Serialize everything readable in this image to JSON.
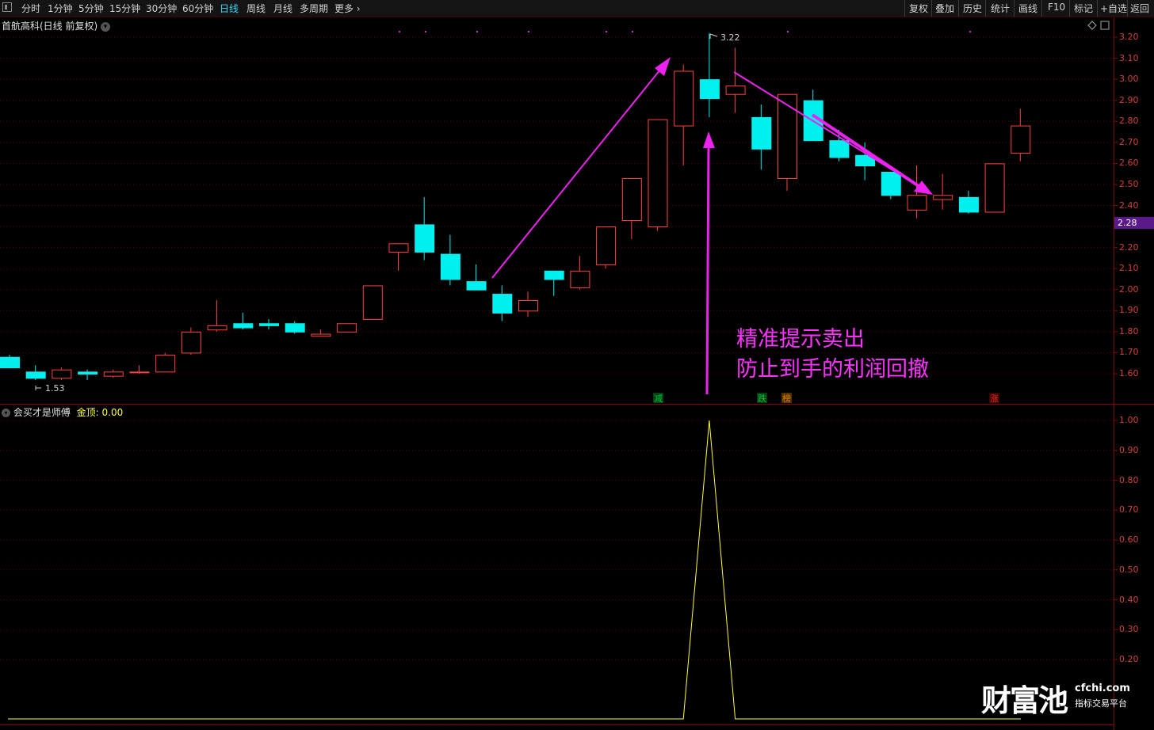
{
  "toolbar": {
    "left_items": [
      "分时",
      "1分钟",
      "5分钟",
      "15分钟",
      "30分钟",
      "60分钟",
      "日线",
      "周线",
      "月线",
      "多周期",
      "更多"
    ],
    "active_item": "日线",
    "right_items": [
      "复权",
      "叠加",
      "历史",
      "统计",
      "画线",
      "F10",
      "标记",
      "+自选",
      "返回"
    ]
  },
  "stock": {
    "title": "首航高科(日线 前复权)",
    "current_price": "2.28",
    "high_label": "3.22",
    "low_label": "1.53"
  },
  "price_axis": {
    "labels": [
      "3.20",
      "3.10",
      "3.00",
      "2.90",
      "2.80",
      "2.70",
      "2.60",
      "2.50",
      "2.40",
      "2.30",
      "2.20",
      "2.10",
      "2.00",
      "1.90",
      "1.80",
      "1.70",
      "1.60"
    ]
  },
  "indicator": {
    "name": "会买才是师傅",
    "series_label": "金顶:",
    "series_value": "0.00",
    "axis_labels": [
      "1.00",
      "0.90",
      "0.80",
      "0.70",
      "0.60",
      "0.50",
      "0.40",
      "0.30",
      "0.20"
    ]
  },
  "signals": [
    {
      "text": "减",
      "color": "#00c040"
    },
    {
      "text": "跌",
      "color": "#00c040"
    },
    {
      "text": "榜",
      "color": "#e08000"
    },
    {
      "text": "涨",
      "color": "#e03030"
    }
  ],
  "annotation": {
    "line1": "精准提示卖出",
    "line2": "防止到手的利润回撤"
  },
  "watermark": {
    "brand": "财富池",
    "site": "cfchi.com",
    "tagline": "指标交易平台"
  },
  "colors": {
    "up": "#ff4040",
    "down": "#00f0f0",
    "arrow": "#ee22ee",
    "indicator_line": "#ffff30",
    "grid": "#5a0000"
  },
  "chart_data": {
    "type": "candlestick",
    "candles": [
      {
        "o": 1.68,
        "h": 1.69,
        "l": 1.63,
        "c": 1.63
      },
      {
        "o": 1.61,
        "h": 1.64,
        "l": 1.57,
        "c": 1.58
      },
      {
        "o": 1.58,
        "h": 1.63,
        "l": 1.57,
        "c": 1.62
      },
      {
        "o": 1.61,
        "h": 1.62,
        "l": 1.57,
        "c": 1.6
      },
      {
        "o": 1.59,
        "h": 1.62,
        "l": 1.58,
        "c": 1.61
      },
      {
        "o": 1.61,
        "h": 1.64,
        "l": 1.6,
        "c": 1.61
      },
      {
        "o": 1.61,
        "h": 1.7,
        "l": 1.61,
        "c": 1.69
      },
      {
        "o": 1.7,
        "h": 1.82,
        "l": 1.69,
        "c": 1.8
      },
      {
        "o": 1.81,
        "h": 1.95,
        "l": 1.8,
        "c": 1.83
      },
      {
        "o": 1.84,
        "h": 1.89,
        "l": 1.81,
        "c": 1.82
      },
      {
        "o": 1.84,
        "h": 1.86,
        "l": 1.81,
        "c": 1.83
      },
      {
        "o": 1.84,
        "h": 1.85,
        "l": 1.79,
        "c": 1.8
      },
      {
        "o": 1.78,
        "h": 1.81,
        "l": 1.78,
        "c": 1.79
      },
      {
        "o": 1.8,
        "h": 1.84,
        "l": 1.8,
        "c": 1.84
      },
      {
        "o": 1.86,
        "h": 2.02,
        "l": 1.86,
        "c": 2.02
      },
      {
        "o": 2.18,
        "h": 2.22,
        "l": 2.09,
        "c": 2.22
      },
      {
        "o": 2.31,
        "h": 2.44,
        "l": 2.14,
        "c": 2.18
      },
      {
        "o": 2.17,
        "h": 2.26,
        "l": 2.02,
        "c": 2.05
      },
      {
        "o": 2.04,
        "h": 2.12,
        "l": 2.0,
        "c": 2.0
      },
      {
        "o": 1.98,
        "h": 2.02,
        "l": 1.85,
        "c": 1.89
      },
      {
        "o": 1.9,
        "h": 1.99,
        "l": 1.87,
        "c": 1.95
      },
      {
        "o": 2.09,
        "h": 2.09,
        "l": 1.97,
        "c": 2.05
      },
      {
        "o": 2.01,
        "h": 2.16,
        "l": 2.0,
        "c": 2.09
      },
      {
        "o": 2.12,
        "h": 2.3,
        "l": 2.1,
        "c": 2.3
      },
      {
        "o": 2.33,
        "h": 2.53,
        "l": 2.24,
        "c": 2.53
      },
      {
        "o": 2.3,
        "h": 2.81,
        "l": 2.28,
        "c": 2.81
      },
      {
        "o": 2.78,
        "h": 3.07,
        "l": 2.59,
        "c": 3.04
      },
      {
        "o": 3.0,
        "h": 3.22,
        "l": 2.82,
        "c": 2.91
      },
      {
        "o": 2.93,
        "h": 3.15,
        "l": 2.84,
        "c": 2.97
      },
      {
        "o": 2.82,
        "h": 2.88,
        "l": 2.57,
        "c": 2.67
      },
      {
        "o": 2.53,
        "h": 2.93,
        "l": 2.47,
        "c": 2.93
      },
      {
        "o": 2.9,
        "h": 2.95,
        "l": 2.71,
        "c": 2.71
      },
      {
        "o": 2.71,
        "h": 2.76,
        "l": 2.61,
        "c": 2.63
      },
      {
        "o": 2.64,
        "h": 2.7,
        "l": 2.52,
        "c": 2.59
      },
      {
        "o": 2.56,
        "h": 2.56,
        "l": 2.43,
        "c": 2.45
      },
      {
        "o": 2.38,
        "h": 2.59,
        "l": 2.34,
        "c": 2.45
      },
      {
        "o": 2.43,
        "h": 2.55,
        "l": 2.38,
        "c": 2.45
      },
      {
        "o": 2.44,
        "h": 2.47,
        "l": 2.36,
        "c": 2.37
      },
      {
        "o": 2.37,
        "h": 2.6,
        "l": 2.37,
        "c": 2.6
      },
      {
        "o": 2.65,
        "h": 2.86,
        "l": 2.61,
        "c": 2.78
      }
    ],
    "indicator_values": [
      0,
      0,
      0,
      0,
      0,
      0,
      0,
      0,
      0,
      0,
      0,
      0,
      0,
      0,
      0,
      0,
      0,
      0,
      0,
      0,
      0,
      0,
      0,
      0,
      0,
      0,
      0,
      1,
      0,
      0,
      0,
      0,
      0,
      0,
      0,
      0,
      0,
      0,
      0,
      0
    ],
    "ylim_price": [
      1.5,
      3.25
    ],
    "ylim_indicator": [
      0,
      1.05
    ],
    "grid": true
  }
}
